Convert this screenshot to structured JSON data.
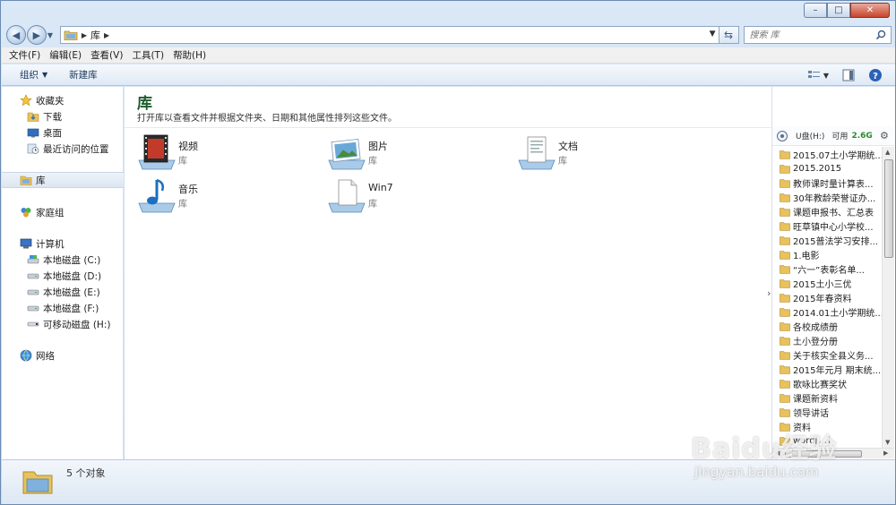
{
  "window": {
    "address_crumb": "库",
    "search_placeholder": "搜索 库",
    "controls": {
      "minimize": "–",
      "maximize": "□",
      "close": "✕"
    }
  },
  "menu": [
    "文件(F)",
    "编辑(E)",
    "查看(V)",
    "工具(T)",
    "帮助(H)"
  ],
  "toolbar": {
    "organize": "组织",
    "new_library": "新建库"
  },
  "sidebar": {
    "favorites": {
      "label": "收藏夹",
      "items": [
        "下载",
        "桌面",
        "最近访问的位置"
      ]
    },
    "libraries": "库",
    "homegroup": "家庭组",
    "computer": {
      "label": "计算机",
      "drives": [
        "本地磁盘 (C:)",
        "本地磁盘 (D:)",
        "本地磁盘 (E:)",
        "本地磁盘 (F:)",
        "可移动磁盘 (H:)"
      ]
    },
    "network": "网络"
  },
  "main": {
    "title": "库",
    "description": "打开库以查看文件并根据文件夹、日期和其他属性排列这些文件。",
    "libraries": [
      {
        "name": "视频",
        "type": "库",
        "icon": "video-library-icon"
      },
      {
        "name": "图片",
        "type": "库",
        "icon": "pictures-library-icon"
      },
      {
        "name": "文档",
        "type": "库",
        "icon": "documents-library-icon"
      },
      {
        "name": "音乐",
        "type": "库",
        "icon": "music-library-icon"
      },
      {
        "name": "Win7",
        "type": "库",
        "icon": "generic-library-icon"
      }
    ]
  },
  "pane": {
    "drive_label": "U盘(H:)",
    "free_prefix": "可用",
    "free_value": "2.6G",
    "folders": [
      "2015.07土小学期统...",
      "2015.2015",
      "教师课时量计算表...",
      "30年教龄荣誉证办...",
      "课题申报书、汇总表",
      "旺草镇中心小学校...",
      "2015普法学习安排...",
      "1.电影",
      "“六一”表彰名单...",
      "2015土小三优",
      "2015年春资料",
      "2014.01土小学期统...",
      "各校成绩册",
      "土小登分册",
      "关于核实全县义务...",
      "2015年元月 期末统...",
      "歌咏比赛奖状",
      "课题新资料",
      "领导讲话",
      "资料",
      "word[...]"
    ]
  },
  "status": {
    "text": "5 个对象"
  },
  "watermark": {
    "brand": "Baidu经验",
    "url": "jingyan.baidu.com"
  },
  "colors": {
    "title_green": "#1e5c2d",
    "free_green": "#2b8a2b",
    "folder_yellow": "#e8c25a"
  }
}
